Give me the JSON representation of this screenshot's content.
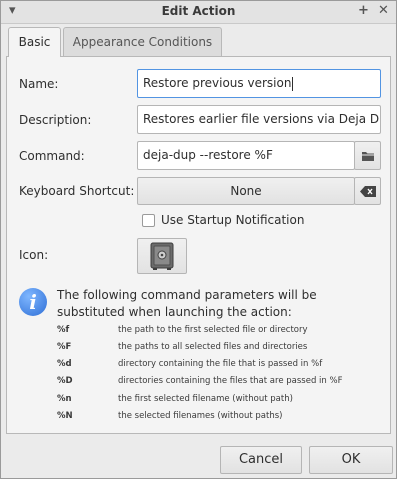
{
  "window": {
    "title": "Edit Action"
  },
  "tabs": [
    {
      "label": "Basic",
      "active": true
    },
    {
      "label": "Appearance Conditions",
      "active": false
    }
  ],
  "form": {
    "name_label": "Name:",
    "name_value": "Restore previous version",
    "description_label": "Description:",
    "description_value": "Restores earlier file versions via Deja Dup",
    "command_label": "Command:",
    "command_value": "deja-dup --restore %F",
    "shortcut_label": "Keyboard Shortcut:",
    "shortcut_value": "None",
    "startup_notification_label": "Use Startup Notification",
    "startup_notification_checked": false,
    "icon_label": "Icon:"
  },
  "info": {
    "text": "The following command parameters will be substituted when launching the action:",
    "params": [
      {
        "code": "%f",
        "desc": "the path to the first selected file or directory"
      },
      {
        "code": "%F",
        "desc": "the paths to all selected files and directories"
      },
      {
        "code": "%d",
        "desc": "directory containing the file that is passed in %f"
      },
      {
        "code": "%D",
        "desc": "directories containing the files that are passed in %F"
      },
      {
        "code": "%n",
        "desc": "the first selected filename (without path)"
      },
      {
        "code": "%N",
        "desc": "the selected filenames (without paths)"
      }
    ]
  },
  "buttons": {
    "cancel": "Cancel",
    "ok": "OK"
  },
  "colors": {
    "focus": "#5294e2",
    "info_icon": "#2f6fd6"
  }
}
